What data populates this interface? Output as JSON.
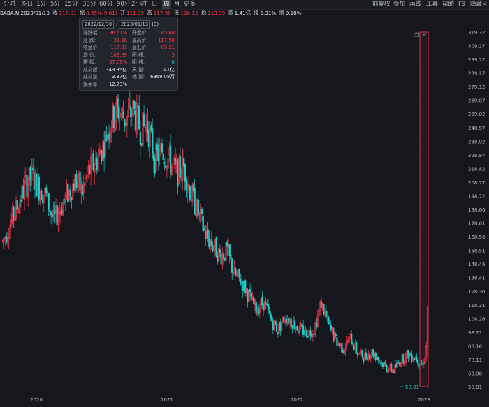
{
  "toolbar": {
    "left_items": [
      "分时",
      "多日",
      "1分",
      "5分",
      "15分",
      "30分",
      "60分",
      "90分",
      "2小时",
      "日",
      "周",
      "月",
      "更多"
    ],
    "active_item": "周",
    "right_items": [
      "前复权",
      "叠加",
      "画线",
      "工具",
      "帮助",
      "F9",
      "隐藏<"
    ]
  },
  "infobar": {
    "symbol_date": "BABA.N 2023/01/13",
    "close_label": "收",
    "close_value": "117.01",
    "change_label": "幅",
    "change_value": "8.65%(9.81)",
    "open_label": "开",
    "open_value": "111.99",
    "high_label": "高",
    "high_value": "117.98",
    "low_label": "低",
    "low_value": "108.12",
    "avg_label": "均",
    "avg_value": "113.39",
    "volume_label": "量",
    "volume_value": "1.41亿",
    "turnover_label": "换",
    "turnover_value": "5.31%",
    "amplitude_label": "振",
    "amplitude_value": "9.18%"
  },
  "popup": {
    "date_start": "2022/12/30",
    "date_sep": "-",
    "date_end": "2023/01/13",
    "count": "(3)",
    "rows": [
      {
        "l1": "涨跌幅:",
        "v1": "36.61%",
        "c1": "red",
        "l2": "开盘价:",
        "v2": "85.60",
        "c2": "red"
      },
      {
        "l1": "涨  跌:",
        "v1": "31.36",
        "c1": "red",
        "l2": "最高价:",
        "v2": "117.98",
        "c2": "red"
      },
      {
        "l1": "收盘价:",
        "v1": "117.01",
        "c1": "red",
        "l2": "最低价:",
        "v2": "85.21",
        "c2": "red"
      },
      {
        "l1": "均  价:",
        "v1": "103.69",
        "c1": "red",
        "l2": "阳  线:",
        "v2": "3",
        "c2": "red"
      },
      {
        "l1": "振  幅:",
        "v1": "37.09%",
        "c1": "red",
        "l2": "阴  线:",
        "v2": "0",
        "c2": "green"
      },
      {
        "l1": "成交额:",
        "v1": "349.35亿",
        "c1": "white",
        "l2": "天  量:",
        "v2": "1.41亿",
        "c2": "white"
      },
      {
        "l1": "成交量:",
        "v1": "3.37亿",
        "c1": "white",
        "l2": "地  量:",
        "v2": "6369.08万",
        "c2": "white"
      },
      {
        "l1": "换手率:",
        "v1": "12.73%",
        "c1": "white",
        "l2": "",
        "v2": "",
        "c2": "white"
      }
    ]
  },
  "colors": {
    "up": "#ff3b4f",
    "down": "#1fcfc8",
    "bg": "#16171c",
    "grid": "#23252b",
    "selection": "#ff3b4f"
  },
  "chart_data": {
    "type": "candlestick",
    "x_tick_labels": [
      "2020",
      "2021",
      "2022",
      "2023"
    ],
    "y_tick_labels": [
      "319.32",
      "309.27",
      "299.22",
      "289.17",
      "279.12",
      "269.07",
      "259.02",
      "248.97",
      "238.92",
      "228.87",
      "218.82",
      "208.77",
      "198.72",
      "188.66",
      "178.61",
      "168.56",
      "158.51",
      "148.46",
      "138.41",
      "128.36",
      "118.31",
      "108.26",
      "98.21",
      "88.16",
      "78.11",
      "68.06",
      "58.01"
    ],
    "ylim": [
      58.01,
      319.32
    ],
    "min_label": "58.01",
    "selection_range": [
      "2022/12/30",
      "2023/01/13"
    ],
    "anchor_points": [
      [
        0,
        165
      ],
      [
        6,
        178
      ],
      [
        12,
        190
      ],
      [
        18,
        205
      ],
      [
        24,
        213
      ],
      [
        30,
        205
      ],
      [
        36,
        198
      ],
      [
        42,
        180
      ],
      [
        48,
        190
      ],
      [
        54,
        200
      ],
      [
        60,
        210
      ],
      [
        66,
        202
      ],
      [
        72,
        218
      ],
      [
        78,
        225
      ],
      [
        84,
        238
      ],
      [
        90,
        255
      ],
      [
        96,
        262
      ],
      [
        102,
        255
      ],
      [
        108,
        262
      ],
      [
        114,
        248
      ],
      [
        120,
        250
      ],
      [
        126,
        226
      ],
      [
        132,
        232
      ],
      [
        138,
        225
      ],
      [
        144,
        215
      ],
      [
        150,
        220
      ],
      [
        156,
        200
      ],
      [
        162,
        186
      ],
      [
        168,
        170
      ],
      [
        174,
        162
      ],
      [
        180,
        155
      ],
      [
        186,
        158
      ],
      [
        192,
        140
      ],
      [
        198,
        136
      ],
      [
        204,
        125
      ],
      [
        210,
        115
      ],
      [
        216,
        120
      ],
      [
        222,
        108
      ],
      [
        228,
        100
      ],
      [
        234,
        110
      ],
      [
        240,
        106
      ],
      [
        246,
        100
      ],
      [
        252,
        98
      ],
      [
        258,
        100
      ],
      [
        264,
        120
      ],
      [
        270,
        103
      ],
      [
        276,
        92
      ],
      [
        282,
        86
      ],
      [
        288,
        94
      ],
      [
        294,
        83
      ],
      [
        300,
        80
      ],
      [
        306,
        84
      ],
      [
        312,
        78
      ],
      [
        318,
        72
      ],
      [
        324,
        70
      ],
      [
        330,
        78
      ],
      [
        336,
        82
      ],
      [
        342,
        80
      ],
      [
        348,
        74
      ],
      [
        350,
        82
      ],
      [
        351,
        88
      ],
      [
        352,
        117
      ]
    ]
  }
}
